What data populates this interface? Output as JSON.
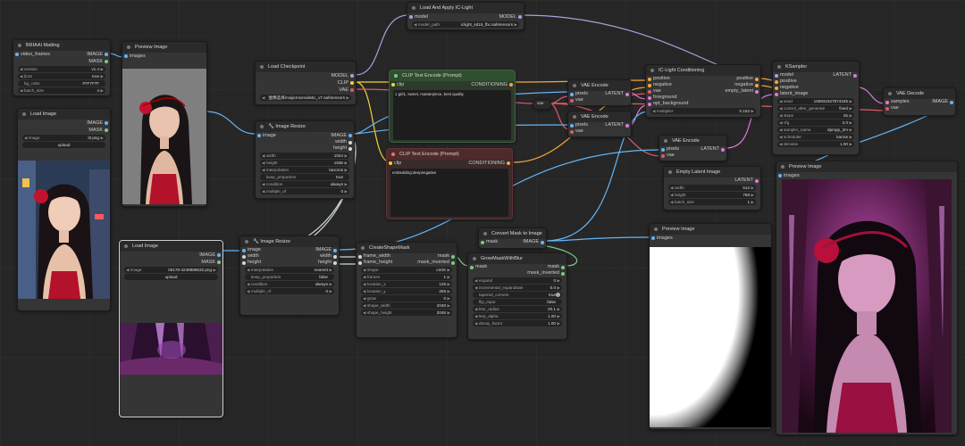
{
  "nodes": {
    "birefnet": {
      "title": "BRIAAI Matting",
      "inputs": [
        "video_frames"
      ],
      "outputs": [
        "IMAGE",
        "MASK"
      ],
      "widgets": [
        {
          "k": "version",
          "v": "v1.4"
        },
        {
          "k": "fp16",
          "v": "true"
        },
        {
          "k": "bg_color",
          "v": "#7F7F7F"
        },
        {
          "k": "batch_size",
          "v": "4"
        }
      ]
    },
    "preview1": {
      "title": "Preview Image",
      "inputs": [
        "images"
      ]
    },
    "load1": {
      "title": "Load Image",
      "outputs": [
        "IMAGE",
        "MASK"
      ],
      "widgets": [
        {
          "k": "image",
          "v": "l3.png"
        }
      ],
      "upload": "upload"
    },
    "checkpoint": {
      "title": "Load Checkpoint",
      "outputs": [
        "MODEL",
        "CLIP",
        "VAE"
      ],
      "widgets": [
        {
          "k": "ckpt_name",
          "v": "图像选择\\majicmixrealistic_v7.safetensors"
        }
      ]
    },
    "iclight": {
      "title": "Load And Apply IC-Light",
      "inputs": [
        "model"
      ],
      "outputs": [
        "MODEL"
      ],
      "widgets": [
        {
          "k": "model_path",
          "v": "iclight_sd15_fbc.safetensors"
        }
      ]
    },
    "clip_pos": {
      "title": "CLIP Text Encode (Prompt)",
      "inputs": [
        "clip"
      ],
      "outputs": [
        "CONDITIONING"
      ],
      "text": "1 girl1, sweet, masterpiece, best quality"
    },
    "clip_neg": {
      "title": "CLIP Text Encode (Prompt)",
      "inputs": [
        "clip"
      ],
      "outputs": [
        "CONDITIONING"
      ],
      "text": "embedding:deepnegative"
    },
    "resize1": {
      "title": "🔧 Image Resize",
      "inputs": [
        "image"
      ],
      "outputs": [
        "IMAGE",
        "width",
        "height"
      ],
      "widgets": [
        {
          "k": "width",
          "v": "1024"
        },
        {
          "k": "height",
          "v": "1536"
        },
        {
          "k": "interpolation",
          "v": "lanczos"
        },
        {
          "k": "keep_proportion",
          "v": "true"
        },
        {
          "k": "condition",
          "v": "always"
        },
        {
          "k": "multiple_of",
          "v": "0"
        }
      ]
    },
    "vae1": {
      "title": "VAE Encode",
      "inputs": [
        "pixels",
        "vae"
      ],
      "outputs": [
        "LATENT"
      ]
    },
    "vae2": {
      "title": "VAE Encode",
      "inputs": [
        "pixels",
        "vae"
      ],
      "outputs": [
        "LATENT"
      ]
    },
    "vae3": {
      "title": "VAE Encode",
      "inputs": [
        "pixels",
        "vae"
      ],
      "outputs": [
        "LATENT"
      ]
    },
    "reroute": {
      "label": "vae"
    },
    "iccond": {
      "title": "IC-Light Conditioning",
      "inputs": [
        "positive",
        "negative",
        "vae",
        "foreground",
        "opt_background"
      ],
      "outputs": [
        "positive",
        "negative",
        "empty_latent"
      ],
      "widgets": [
        {
          "k": "multiplier",
          "v": "0.182"
        }
      ]
    },
    "ksampler": {
      "title": "KSampler",
      "inputs": [
        "model",
        "positive",
        "negative",
        "latent_image"
      ],
      "outputs": [
        "LATENT"
      ],
      "widgets": [
        {
          "k": "seed",
          "v": "166931827874345"
        },
        {
          "k": "control_after_generate",
          "v": "fixed"
        },
        {
          "k": "steps",
          "v": "25"
        },
        {
          "k": "cfg",
          "v": "2.0"
        },
        {
          "k": "sampler_name",
          "v": "dpmpp_2m"
        },
        {
          "k": "scheduler",
          "v": "karras"
        },
        {
          "k": "denoise",
          "v": "1.00"
        }
      ]
    },
    "vaedecode": {
      "title": "VAE Decode",
      "inputs": [
        "samples",
        "vae"
      ],
      "outputs": [
        "IMAGE"
      ]
    },
    "emptylatent": {
      "title": "Empty Latent Image",
      "outputs": [
        "LATENT"
      ],
      "widgets": [
        {
          "k": "width",
          "v": "512"
        },
        {
          "k": "height",
          "v": "768"
        },
        {
          "k": "batch_size",
          "v": "1"
        }
      ]
    },
    "preview_final": {
      "title": "Preview Image",
      "inputs": [
        "images"
      ]
    },
    "load2": {
      "title": "Load Image",
      "outputs": [
        "IMAGE",
        "MASK"
      ],
      "widgets": [
        {
          "k": "image",
          "v": "00178-4248888532.png"
        }
      ],
      "upload": "upload"
    },
    "resize2": {
      "title": "🔧 Image Resize",
      "inputs": [
        "image",
        "width",
        "height"
      ],
      "outputs": [
        "IMAGE",
        "width",
        "height"
      ],
      "widgets": [
        {
          "k": "interpolation",
          "v": "nearest"
        },
        {
          "k": "keep_proportion",
          "v": "false"
        },
        {
          "k": "condition",
          "v": "always"
        },
        {
          "k": "multiple_of",
          "v": "0"
        }
      ]
    },
    "shapemask": {
      "title": "CreateShapeMask",
      "inputs": [
        "frame_width",
        "frame_height"
      ],
      "outputs": [
        "mask",
        "mask_inverted"
      ],
      "widgets": [
        {
          "k": "shape",
          "v": "circle"
        },
        {
          "k": "frames",
          "v": "1"
        },
        {
          "k": "location_x",
          "v": "125"
        },
        {
          "k": "location_y",
          "v": "256"
        },
        {
          "k": "grow",
          "v": "0"
        },
        {
          "k": "shape_width",
          "v": "2048"
        },
        {
          "k": "shape_height",
          "v": "2048"
        }
      ]
    },
    "convertmask": {
      "title": "Convert Mask to Image",
      "inputs": [
        "mask"
      ],
      "outputs": [
        "IMAGE"
      ]
    },
    "growblur": {
      "title": "GrowMaskWithBlur",
      "inputs": [
        "mask"
      ],
      "outputs": [
        "mask",
        "mask_inverted"
      ],
      "widgets": [
        {
          "k": "expand",
          "v": "0"
        },
        {
          "k": "incremental_expandrate",
          "v": "0.0"
        },
        {
          "k": "tapered_corners",
          "v": "true"
        },
        {
          "k": "flip_input",
          "v": "false"
        },
        {
          "k": "blur_radius",
          "v": "20.1"
        },
        {
          "k": "lerp_alpha",
          "v": "1.00"
        },
        {
          "k": "decay_factor",
          "v": "1.00"
        }
      ]
    },
    "preview_mask": {
      "title": "Preview Image",
      "inputs": [
        "images"
      ]
    }
  }
}
